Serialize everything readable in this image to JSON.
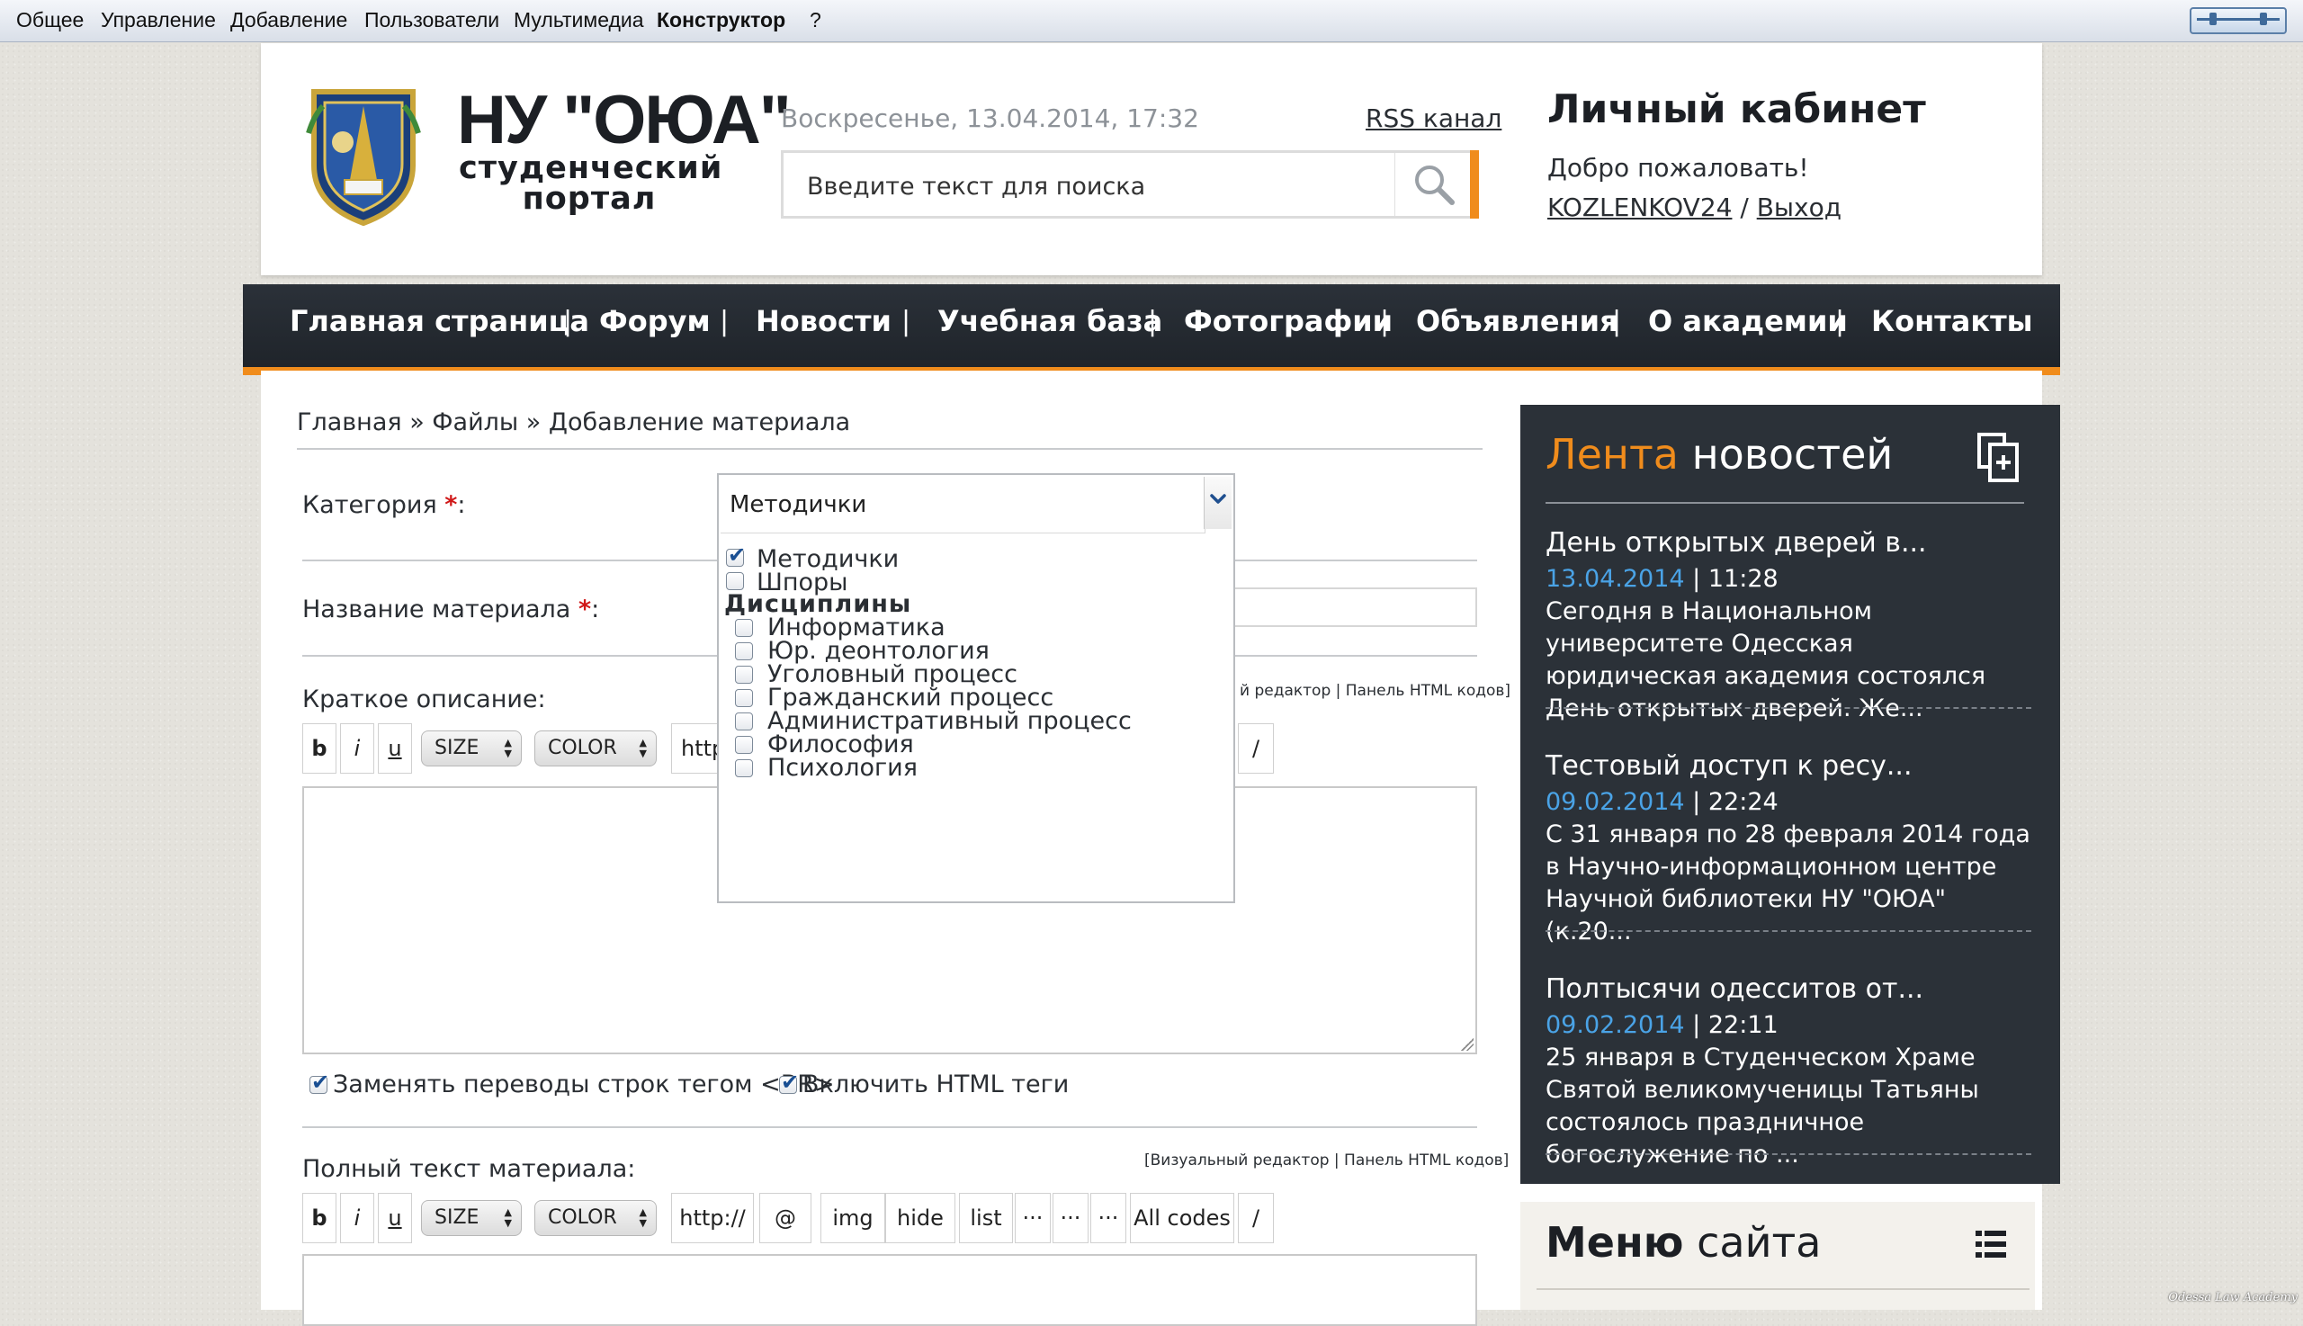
{
  "admin_bar": {
    "items": [
      "Общее",
      "Управление",
      "Добавление",
      "Пользователи",
      "Мультимедиа",
      "Конструктор",
      "?"
    ]
  },
  "header": {
    "site_title": "НУ \"ОЮА\"",
    "site_subtitle_1": "студенческий",
    "site_subtitle_2": "портал",
    "datetime": "Воскресенье, 13.04.2014, 17:32",
    "rss_label": "RSS канал",
    "search_placeholder": "Введите текст для поиска",
    "cabinet_title": "Личный кабинет",
    "welcome": "Добро пожаловать!",
    "username": "KOZLENKOV24",
    "user_sep": " / ",
    "logout": "Выход"
  },
  "nav": {
    "items": [
      "Главная страница",
      "Форум",
      "Новости",
      "Учебная база",
      "Фотографии",
      "Объявления",
      "О академии",
      "Контакты"
    ],
    "separator": "|"
  },
  "breadcrumb": "Главная » Файлы » Добавление материала",
  "form": {
    "category_label": "Категория",
    "title_label": "Название материала",
    "required_mark": "*",
    "colon": ":",
    "short_desc_label": "Краткое описание:",
    "full_text_label": "Полный текст материала:",
    "editor_links_short": "й редактор | Панель HTML кодов]",
    "editor_links_full": "[Визуальный редактор | Панель HTML кодов]",
    "toolbar": {
      "bold": "b",
      "italic": "i",
      "underline": "u",
      "size": "SIZE",
      "color": "COLOR",
      "http": "http://",
      "http_partial": "http",
      "email": "@",
      "img": "img",
      "hide": "hide",
      "list": "list",
      "dots": "···",
      "all_codes": "All codes",
      "slash": "/"
    },
    "checkbox_br": "Заменять переводы строк тегом <BR>",
    "checkbox_html": "Включить HTML теги",
    "checkbox_br_checked": true,
    "checkbox_html_checked": true
  },
  "category_dropdown": {
    "selected": "Методички",
    "options": [
      {
        "label": "Методички",
        "checked": true
      },
      {
        "label": "Шпоры",
        "checked": false
      }
    ],
    "group_label": "Дисциплины",
    "group_options": [
      {
        "label": "Информатика",
        "checked": false
      },
      {
        "label": "Юр. деонтология",
        "checked": false
      },
      {
        "label": "Уголовный процесс",
        "checked": false
      },
      {
        "label": "Гражданский процесс",
        "checked": false
      },
      {
        "label": "Административный процесс",
        "checked": false
      },
      {
        "label": "Философия",
        "checked": false
      },
      {
        "label": "Психология",
        "checked": false
      }
    ]
  },
  "news": {
    "title_accent": "Лента",
    "title_rest": " новостей",
    "items": [
      {
        "headline": "День открытых дверей в...",
        "date": "13.04.2014",
        "time": "11:28",
        "text": "Сегодня в Национальном университете Одесская юридическая академия состоялся День открытых дверей. Же..."
      },
      {
        "headline": "Тестовый доступ к ресу...",
        "date": "09.02.2014",
        "time": "22:24",
        "text": "С 31 января по 28 февраля 2014 года в Научно-информационном центре Научной библиотеки НУ \"ОЮА\" (к.20..."
      },
      {
        "headline": "Полтысячи одесситов от...",
        "date": "09.02.2014",
        "time": "22:11",
        "text": "25 января в Студенческом Храме Святой великомученицы Татьяны состоялось праздничное богослужение по ..."
      }
    ],
    "time_sep": " | "
  },
  "site_menu": {
    "title_bold": "Меню",
    "title_rest": " сайта"
  },
  "watermark": "Odessa Law Academy",
  "colors": {
    "accent_orange": "#f08c1c",
    "dark_panel": "#2b3138",
    "date_blue": "#4aa3e6",
    "required_red": "#d01818"
  }
}
